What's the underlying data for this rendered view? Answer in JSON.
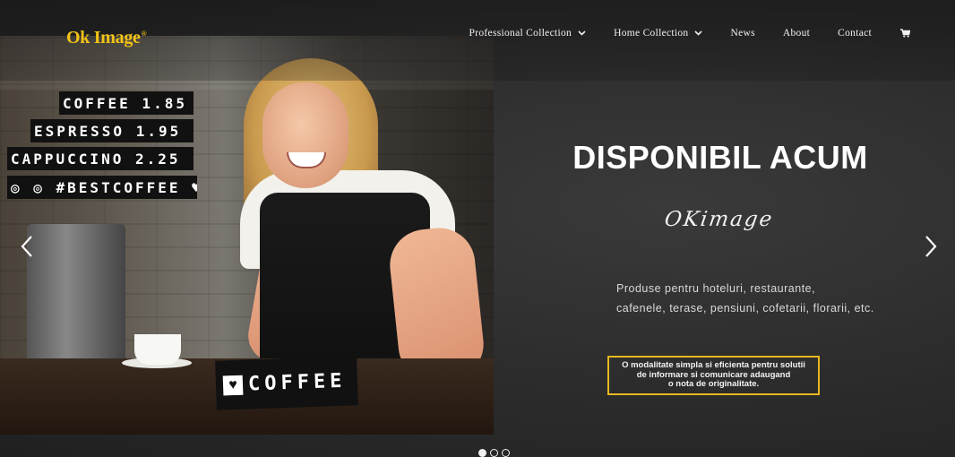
{
  "brand": {
    "logo_text": "Ok Image",
    "logo_mark": "®",
    "accent_color": "#f3c316"
  },
  "nav": {
    "items": [
      {
        "label": "Professional Collection",
        "has_dropdown": true
      },
      {
        "label": "Home Collection",
        "has_dropdown": true
      },
      {
        "label": "News",
        "has_dropdown": false
      },
      {
        "label": "About",
        "has_dropdown": false
      },
      {
        "label": "Contact",
        "has_dropdown": false
      }
    ],
    "cart_icon": "cart-icon"
  },
  "photo": {
    "menu_board": [
      "COFFEE 1.85",
      "ESPRESSO 1.95",
      "CAPPUCCINO 2.25",
      "◎ ◎ #BESTCOFFEE ♥"
    ],
    "counter_sign": {
      "heart": "♥",
      "text": "COFFEE"
    }
  },
  "hero": {
    "title": "DISPONIBIL ACUM",
    "signature": "OKimage",
    "description_lines": [
      "Produse pentru hoteluri, restaurante,",
      "cafenele, terase, pensiuni, cofetarii, florarii, etc."
    ],
    "cta_lines": [
      "O modalitate simpla si eficienta pentru solutii",
      "de informare si comunicare adaugand",
      "o nota de originalitate."
    ],
    "cta_border_color": "#e8b820"
  },
  "slider": {
    "prev_icon": "chevron-left-icon",
    "next_icon": "chevron-right-icon",
    "dots": 3,
    "active_dot": 1
  }
}
